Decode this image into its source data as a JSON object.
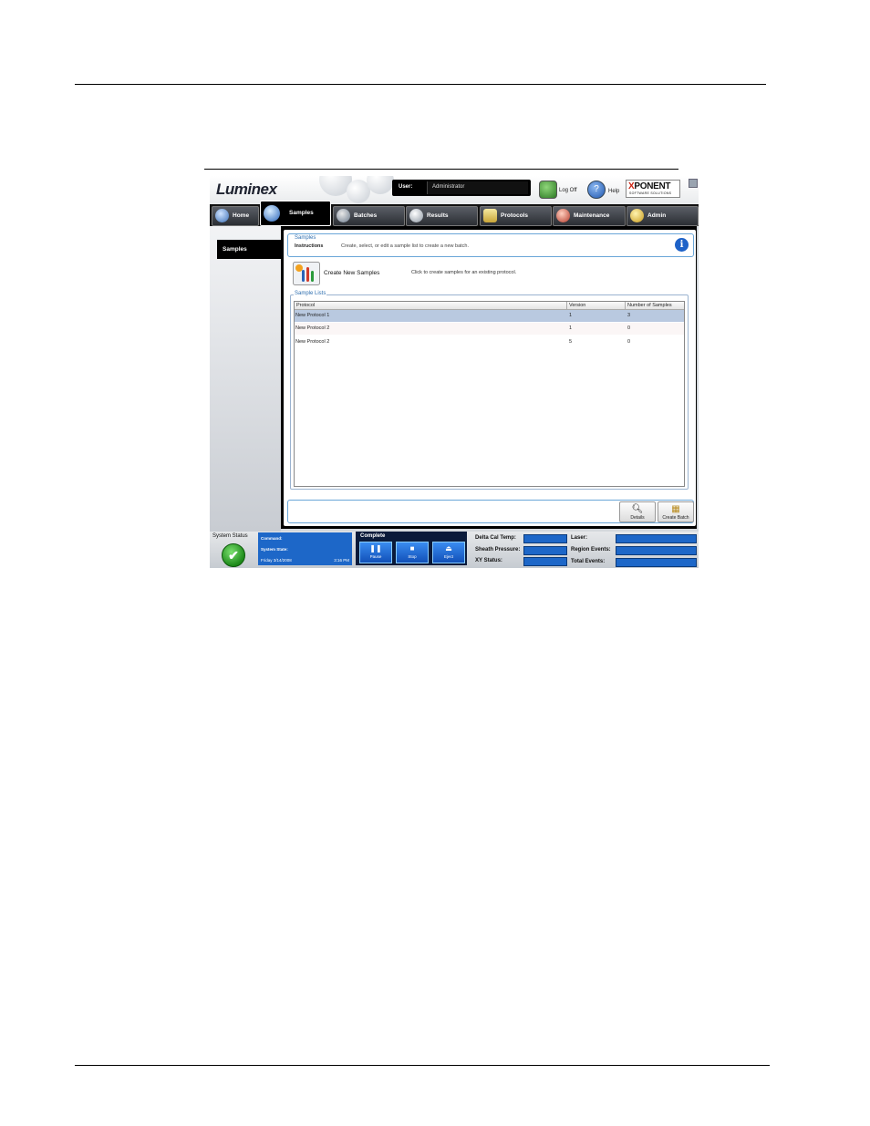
{
  "app": {
    "logo": "Luminex",
    "user_label": "User:",
    "user_value": "Administrator",
    "logoff_label": "Log Off",
    "help_label": "Help",
    "brand_main": "PONENT",
    "brand_x": "X",
    "brand_sub": "SOFTWARE SOLUTIONS"
  },
  "tabs": [
    {
      "label": "Home",
      "icon": "home-icon"
    },
    {
      "label": "Samples",
      "icon": "samples-icon"
    },
    {
      "label": "Batches",
      "icon": "batches-icon"
    },
    {
      "label": "Results",
      "icon": "results-icon"
    },
    {
      "label": "Protocols",
      "icon": "protocols-icon"
    },
    {
      "label": "Maintenance",
      "icon": "maintenance-icon"
    },
    {
      "label": "Admin",
      "icon": "admin-icon"
    }
  ],
  "sidebar": {
    "items": [
      {
        "label": "Samples"
      }
    ]
  },
  "instructions": {
    "title": "Samples",
    "label": "Instructions",
    "text": "Create, select, or edit a sample list to create a new batch."
  },
  "create": {
    "label": "Create New Samples",
    "description": "Click to create samples for an existing protocol."
  },
  "sample_lists": {
    "legend": "Sample Lists",
    "columns": [
      "Protocol",
      "Version",
      "Number of Samples"
    ],
    "rows": [
      {
        "protocol": "New Protocol 1",
        "version": "1",
        "count": "3"
      },
      {
        "protocol": "New Protocol 2",
        "version": "1",
        "count": "0"
      },
      {
        "protocol": "New Protocol 2",
        "version": "5",
        "count": "0"
      }
    ]
  },
  "buttons": {
    "details": "Details",
    "create_batch": "Create Batch"
  },
  "status": {
    "system_status_label": "System Status",
    "command_label": "Command:",
    "system_state_label": "System State:",
    "date": "Friday 3/14/2008",
    "time": "3:16 PM",
    "complete": "Complete",
    "pause": "Pause",
    "stop": "Stop",
    "eject": "Eject",
    "delta_cal_temp": "Delta Cal Temp:",
    "sheath_pressure": "Sheath Pressure:",
    "xy_status": "XY Status:",
    "laser": "Laser:",
    "region_events": "Region Events:",
    "total_events": "Total Events:"
  }
}
